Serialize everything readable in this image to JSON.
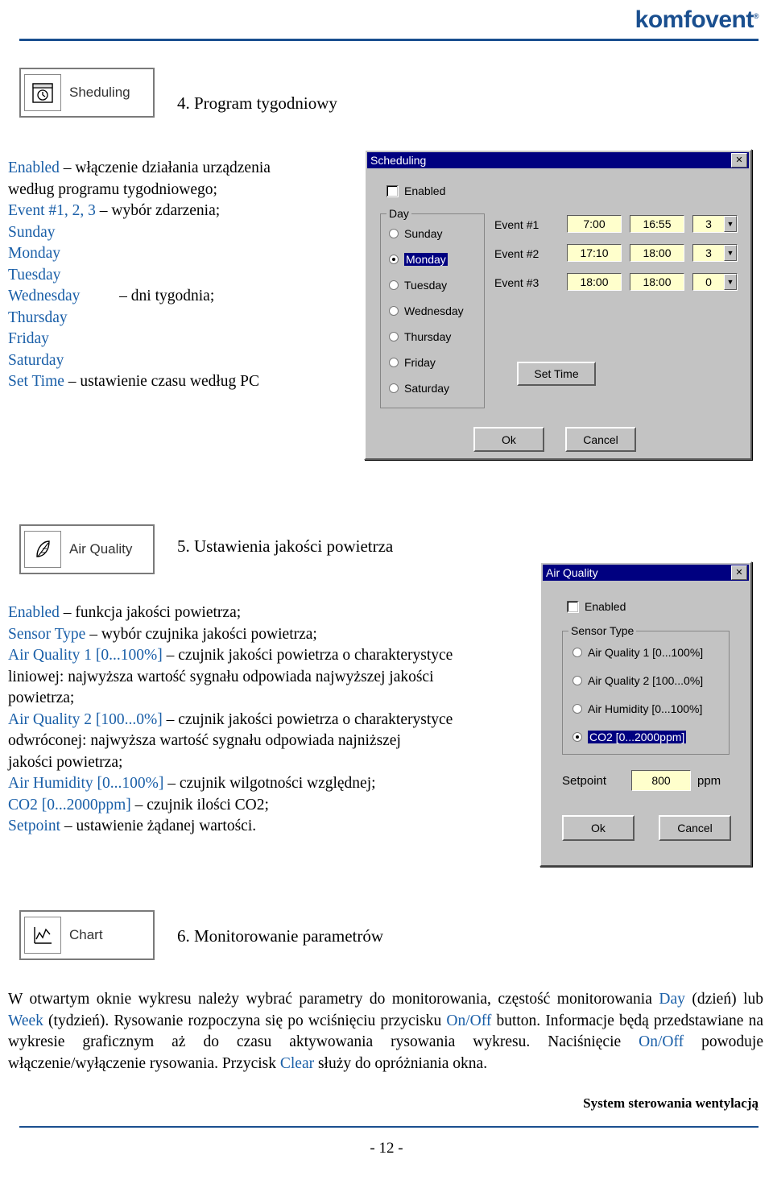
{
  "brand": {
    "name": "komfovent",
    "registered": "®"
  },
  "sections": [
    {
      "chip": {
        "icon": "scheduling-icon",
        "label": "Sheduling"
      },
      "title": "4. Program tygodniowy",
      "lines": [
        {
          "term": "Enabled",
          "rest": " – włączenie działania urządzenia"
        },
        {
          "term": "",
          "rest": "według programu tygodniowego;"
        },
        {
          "term": "Event #1, 2, 3",
          "rest": " – wybór zdarzenia;"
        },
        {
          "term": "Sunday",
          "rest": ""
        },
        {
          "term": "Monday",
          "rest": ""
        },
        {
          "term": "Tuesday",
          "rest": ""
        },
        {
          "term": "Wednesday",
          "rest": "          – dni tygodnia;"
        },
        {
          "term": "Thursday",
          "rest": ""
        },
        {
          "term": "Friday",
          "rest": ""
        },
        {
          "term": "Saturday",
          "rest": ""
        },
        {
          "term": "Set Time",
          "rest": " – ustawienie czasu według PC"
        }
      ]
    }
  ],
  "scheduling_dialog": {
    "title": "Scheduling",
    "close_label": "✕",
    "enabled_label": "Enabled",
    "day_group_title": "Day",
    "days": [
      {
        "label": "Sunday",
        "selected": false
      },
      {
        "label": "Monday",
        "selected": true
      },
      {
        "label": "Tuesday",
        "selected": false
      },
      {
        "label": "Wednesday",
        "selected": false
      },
      {
        "label": "Thursday",
        "selected": false
      },
      {
        "label": "Friday",
        "selected": false
      },
      {
        "label": "Saturday",
        "selected": false
      }
    ],
    "events": [
      {
        "label": "Event #1",
        "start": "7:00",
        "stop": "16:55",
        "mode": "3"
      },
      {
        "label": "Event #2",
        "start": "17:10",
        "stop": "18:00",
        "mode": "3"
      },
      {
        "label": "Event #3",
        "start": "18:00",
        "stop": "18:00",
        "mode": "0"
      }
    ],
    "set_time_label": "Set Time",
    "ok_label": "Ok",
    "cancel_label": "Cancel"
  },
  "air_quality_section": {
    "chip": {
      "icon": "leaf-icon",
      "label": "Air Quality"
    },
    "title": "5. Ustawienia jakości powietrza",
    "lines": [
      {
        "term": "Enabled",
        "rest": " – funkcja jakości powietrza;"
      },
      {
        "term": "Sensor Type",
        "rest": " – wybór czujnika jakości powietrza;"
      },
      {
        "term": "Air Quality 1 [0...100%]",
        "rest": " – czujnik jakości powietrza o charakterystyce"
      },
      {
        "term": "",
        "rest": "liniowej: najwyższa wartość sygnału odpowiada najwyższej jakości"
      },
      {
        "term": "",
        "rest": "powietrza;"
      },
      {
        "term": "Air Quality 2 [100...0%]",
        "rest": " – czujnik jakości powietrza o charakterystyce"
      },
      {
        "term": "",
        "rest": "odwróconej: najwyższa wartość sygnału odpowiada najniższej"
      },
      {
        "term": "",
        "rest": "jakości powietrza;"
      },
      {
        "term": "Air Humidity [0...100%]",
        "rest": " – czujnik wilgotności względnej;"
      },
      {
        "term": "CO2 [0...2000ppm]",
        "rest": " – czujnik ilości CO2;"
      },
      {
        "term": "Setpoint",
        "rest": " – ustawienie żądanej wartości."
      }
    ]
  },
  "air_quality_dialog": {
    "title": "Air Quality",
    "close_label": "✕",
    "enabled_label": "Enabled",
    "sensor_group_title": "Sensor Type",
    "sensors": [
      {
        "label": "Air Quality 1 [0...100%]",
        "selected": false
      },
      {
        "label": "Air Quality 2 [100...0%]",
        "selected": false
      },
      {
        "label": "Air Humidity [0...100%]",
        "selected": false
      },
      {
        "label": "CO2 [0...2000ppm]",
        "selected": true
      }
    ],
    "setpoint_label": "Setpoint",
    "setpoint_value": "800",
    "setpoint_unit": "ppm",
    "ok_label": "Ok",
    "cancel_label": "Cancel"
  },
  "chart_section": {
    "chip": {
      "icon": "chart-icon",
      "label": "Chart"
    },
    "title": "6. Monitorowanie parametrów",
    "paragraph_parts": [
      {
        "text": "W otwartym oknie wykresu należy wybrać parametry do monitorowania, częstość monitorowania ",
        "blue": false
      },
      {
        "text": "Day",
        "blue": true
      },
      {
        "text": " (dzień) lub ",
        "blue": false
      },
      {
        "text": "Week",
        "blue": true
      },
      {
        "text": " (tydzień). Rysowanie rozpoczyna się po wciśnięciu przycisku ",
        "blue": false
      },
      {
        "text": "On/Off",
        "blue": true
      },
      {
        "text": " button. Informacje będą przedstawiane na wykresie graficznym aż do czasu aktywowania rysowania wykresu. Naciśnięcie ",
        "blue": false
      },
      {
        "text": "On/Off",
        "blue": true
      },
      {
        "text": " powoduje włączenie/wyłączenie rysowania. Przycisk ",
        "blue": false
      },
      {
        "text": "Clear",
        "blue": true
      },
      {
        "text": " służy do opróżniania okna.",
        "blue": false
      }
    ]
  },
  "footer": {
    "note": "System sterowania wentylacją",
    "page": "- 12 -"
  }
}
